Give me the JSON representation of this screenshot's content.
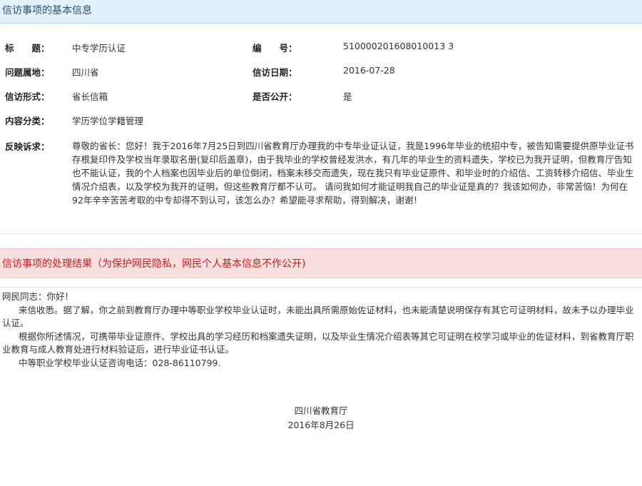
{
  "info_section": {
    "title": "信访事项的基本信息"
  },
  "rows": [
    {
      "label1": "标　　题：",
      "value1": "中专学历认证",
      "label2": "编　　号：",
      "value2": "510000201608010013 3"
    },
    {
      "label1": "问题属地：",
      "value1": "四川省",
      "label2": "信访日期：",
      "value2": "2016-07-28"
    },
    {
      "label1": "信访形式：",
      "value1": "省长信箱",
      "label2": "是否公开：",
      "value2": "是"
    },
    {
      "label1": "内容分类：",
      "value1": "学历学位学籍管理"
    }
  ],
  "complaint": {
    "label": "反映诉求：",
    "text": "尊敬的省长：您好！我于2016年7月25日到四川省教育厅办理我的中专毕业证认证，我是1996年毕业的统招中专，被告知需要提供原毕业证书存根复印件及学校当年录取名册(复印后盖章)，由于我毕业的学校曾经发洪水，有几年的毕业生的资料遗失，学校已为我开证明，但教育厅告知也不能认证，我的个人档案也因毕业后的单位倒闭，档案未移交而遗失，现在我只有毕业证原件、和毕业时的介绍信、工资转移介绍信、毕业生情况介绍表，以及学校为我开的证明，但这些教育厅都不认可。 请问我如何才能证明我自己的毕业证是真的？我该如何办，非常苦恼！为何在92年辛辛苦苦考取的中专却得不到认可，该怎么办？希望能寻求帮助，得到解决，谢谢！"
  },
  "result_section": {
    "title": "信访事项的处理结果（为保护网民隐私，网民个人基本信息不作公开)"
  },
  "reply": {
    "greeting": "网民同志：你好！",
    "p1": "来信收悉。据了解，你之前到教育厅办理中等职业学校毕业认证时，未能出具所需原始佐证材料，也未能清楚说明保存有其它可证明材料，故未予以办理毕业认证。",
    "p2": "根据你所述情况，可携带毕业证原件、学校出具的学习经历和档案遗失证明，以及毕业生情况介绍表等其它可证明在校学习或毕业的佐证材料，到省教育厅职业教育与成人教育处进行材料验证后，进行毕业证书认证。",
    "p3": "中等职业学校毕业认证咨询电话：028-86110799.",
    "signature_org": "四川省教育厅",
    "signature_date": "2016年8月26日"
  }
}
